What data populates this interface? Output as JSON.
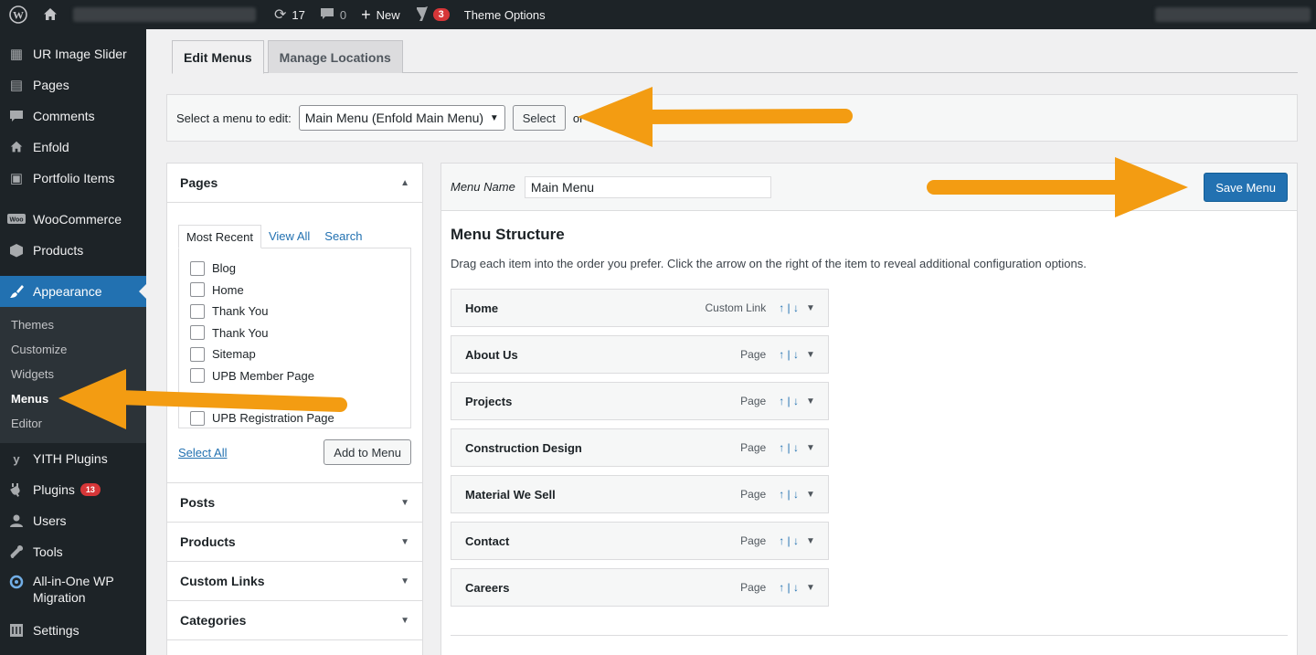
{
  "adminbar": {
    "updates_count": "17",
    "comments_count": "0",
    "new_label": "New",
    "yoast_count": "3",
    "theme_options_label": "Theme Options"
  },
  "sidebar": {
    "items": [
      {
        "label": "UR Image Slider",
        "icon": "slider-icon"
      },
      {
        "label": "Pages",
        "icon": "pages-icon"
      },
      {
        "label": "Comments",
        "icon": "comments-icon"
      },
      {
        "label": "Enfold",
        "icon": "home-icon"
      },
      {
        "label": "Portfolio Items",
        "icon": "portfolio-icon"
      },
      {
        "label": "WooCommerce",
        "icon": "woocommerce-icon"
      },
      {
        "label": "Products",
        "icon": "products-icon"
      },
      {
        "label": "Appearance",
        "icon": "appearance-icon"
      }
    ],
    "appearance_submenu": [
      "Themes",
      "Customize",
      "Widgets",
      "Menus",
      "Editor"
    ],
    "bottom_items": [
      {
        "label": "YITH Plugins",
        "icon": "yith-icon"
      },
      {
        "label": "Plugins",
        "icon": "plugins-icon",
        "count": "13"
      },
      {
        "label": "Users",
        "icon": "users-icon"
      },
      {
        "label": "Tools",
        "icon": "tools-icon"
      },
      {
        "label": "All-in-One WP Migration",
        "icon": "migration-icon"
      },
      {
        "label": "Settings",
        "icon": "settings-icon"
      }
    ]
  },
  "tabs": {
    "edit_menus": "Edit Menus",
    "manage_locations": "Manage Locations"
  },
  "manage": {
    "label": "Select a menu to edit:",
    "selected": "Main Menu (Enfold Main Menu)",
    "select_button": "Select",
    "trailing_text": "or"
  },
  "pages_box": {
    "title": "Pages",
    "tabs": [
      "Most Recent",
      "View All",
      "Search"
    ],
    "items": [
      "Blog",
      "Home",
      "Thank You",
      "Thank You",
      "Sitemap",
      "UPB Member Page",
      "UPB Registration Page"
    ],
    "select_all": "Select All",
    "add_button": "Add to Menu"
  },
  "accordion_sections": [
    "Posts",
    "Products",
    "Custom Links",
    "Categories"
  ],
  "menu_editor": {
    "menu_name_label": "Menu Name",
    "menu_name_value": "Main Menu",
    "save_button": "Save Menu",
    "structure_title": "Menu Structure",
    "structure_desc": "Drag each item into the order you prefer. Click the arrow on the right of the item to reveal additional configuration options.",
    "items": [
      {
        "title": "Home",
        "type": "Custom Link"
      },
      {
        "title": "About Us",
        "type": "Page"
      },
      {
        "title": "Projects",
        "type": "Page"
      },
      {
        "title": "Construction Design",
        "type": "Page"
      },
      {
        "title": "Material We Sell",
        "type": "Page"
      },
      {
        "title": "Contact",
        "type": "Page"
      },
      {
        "title": "Careers",
        "type": "Page"
      }
    ],
    "arrows_glyph": "↑ | ↓",
    "toggle_glyph": "▼"
  },
  "colors": {
    "admin_dark": "#1d2327",
    "accent_blue": "#2271b1",
    "annotation_orange": "#f39c12"
  }
}
